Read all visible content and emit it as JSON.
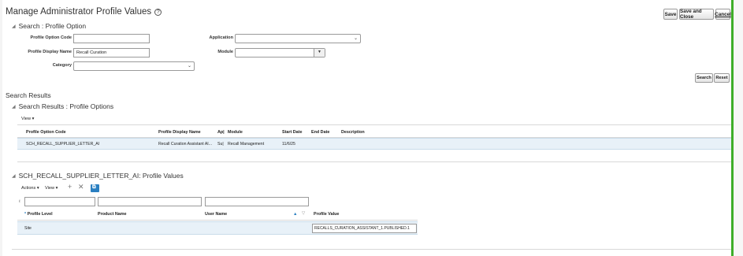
{
  "page": {
    "title": "Manage Administrator Profile Values",
    "help_glyph": "?",
    "buttons": {
      "save": "Save",
      "save_close": "Save and Close",
      "cancel": "Cancel"
    }
  },
  "search": {
    "header": "Search : Profile Option",
    "fields": {
      "profile_option_code": {
        "label": "Profile Option Code",
        "value": ""
      },
      "profile_display_name": {
        "label": "Profile Display Name",
        "value": "Recall Curation"
      },
      "category": {
        "label": "Category",
        "value": ""
      },
      "application": {
        "label": "Application",
        "value": ""
      },
      "module": {
        "label": "Module",
        "value": ""
      }
    },
    "search_button": "Search",
    "reset_button": "Reset"
  },
  "results": {
    "title": "Search Results",
    "header": "Search Results : Profile Options",
    "view_menu": "View ▾",
    "columns": [
      "Profile Option Code",
      "Profile Display Name",
      "Ap|",
      "Module",
      "Start Date",
      "End Date",
      "Description"
    ],
    "rows": [
      {
        "code": "SCH_RECALL_SUPPLIER_LETTER_AI",
        "display_name": "Recall Curation Assistant AI...",
        "app": "Su|",
        "module": "Recall Management",
        "start_date": "11/6/25",
        "end_date": "",
        "description": ""
      }
    ]
  },
  "values": {
    "header": "SCH_RECALL_SUPPLIER_LETTER_AI: Profile Values",
    "actions_menu": "Actions ▾",
    "view_menu": "View ▾",
    "icons": [
      "add-icon",
      "delete-icon",
      "detach-icon"
    ],
    "columns": {
      "required_mark": "*",
      "profile_level": "Profile Level",
      "product_name": "Product Name",
      "user_name": "User Name",
      "profile_value": "Profile Value"
    },
    "rows": [
      {
        "profile_level": "Site",
        "product_name": "",
        "user_name": "",
        "profile_value": "RECALLS_CURATION_ASSISTANT_1.PUBLISHED.1"
      }
    ]
  },
  "colors": {
    "accent_green": "#3fae2a",
    "selected_row": "#e8f1f8",
    "toolbar_blue": "#2a7fc1"
  }
}
